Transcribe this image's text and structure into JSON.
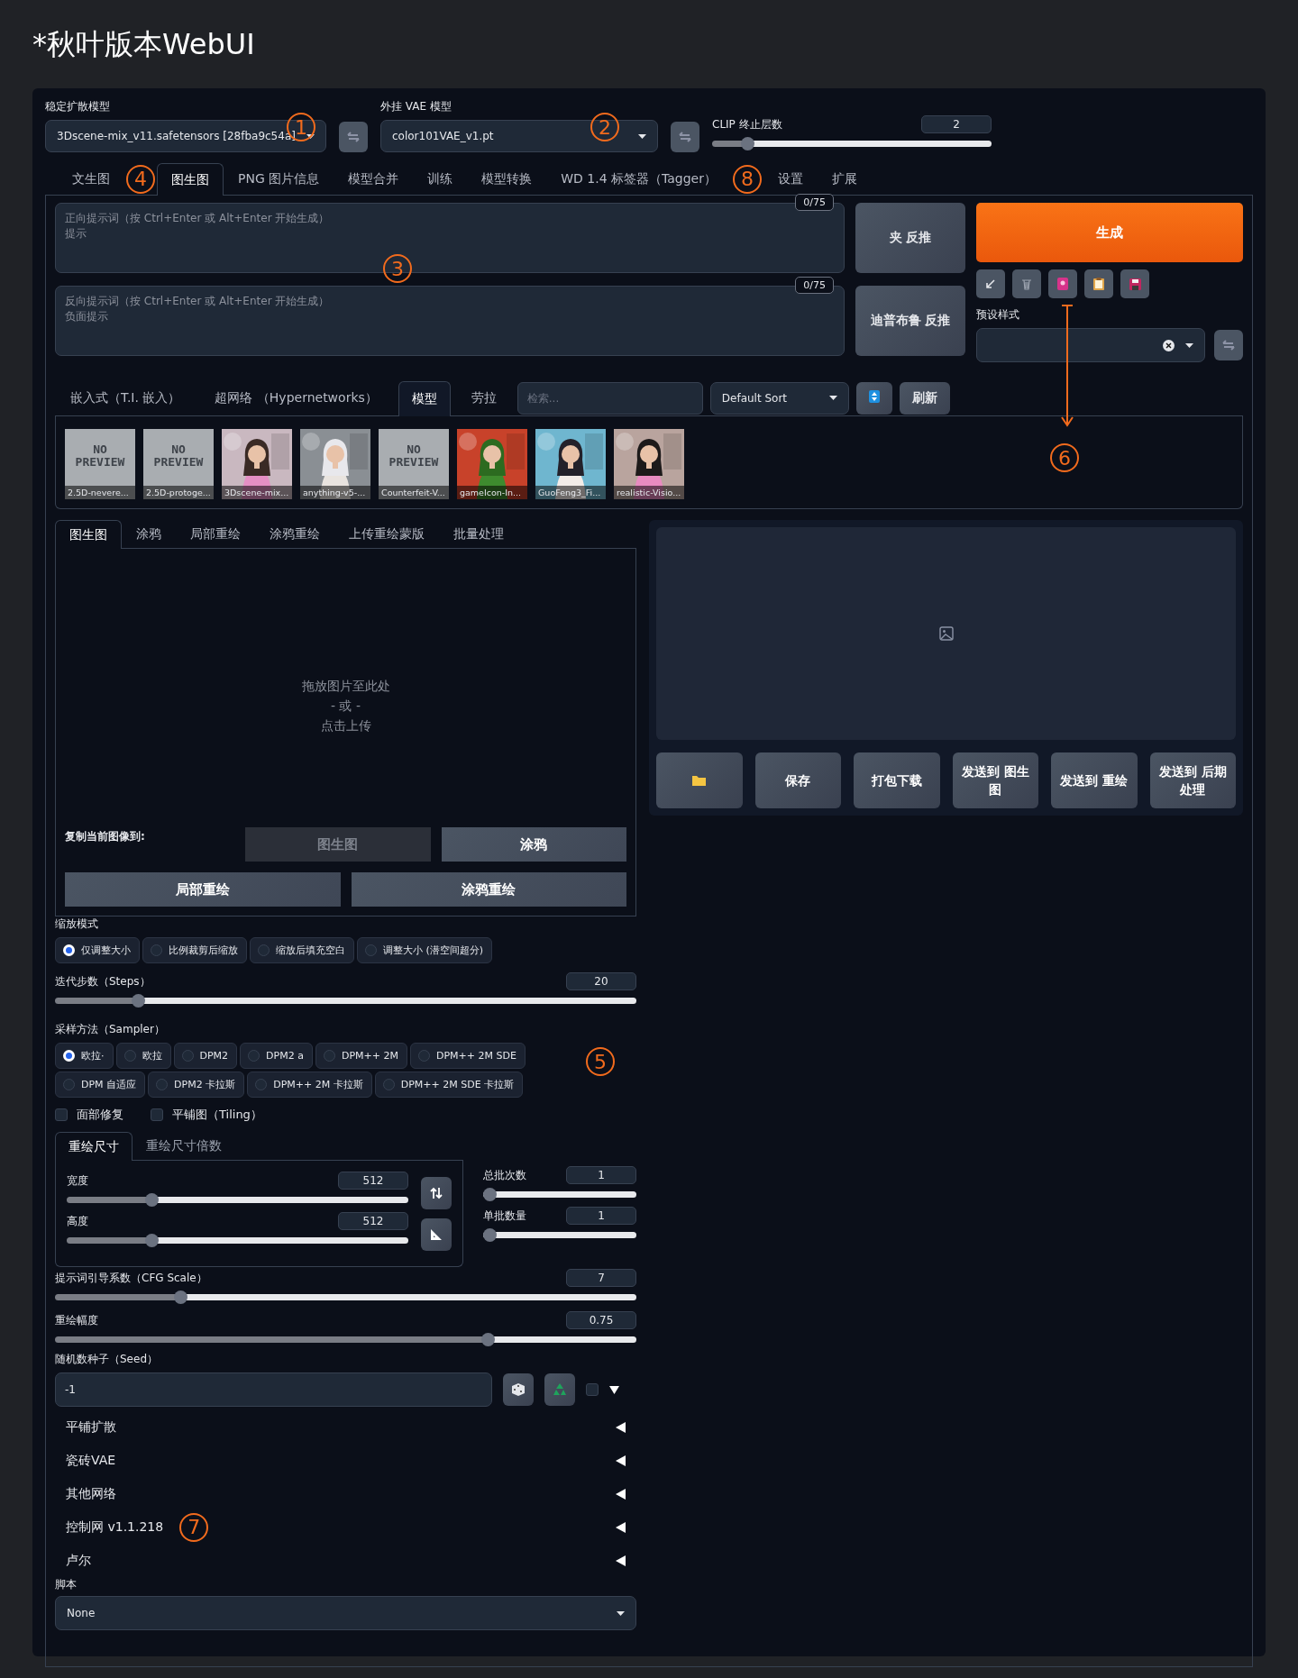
{
  "title": "*秋叶版本WebUI",
  "top": {
    "model": {
      "label": "稳定扩散模型",
      "value": "3Dscene-mix_v11.safetensors [28fba9c54a]"
    },
    "vae": {
      "label": "外挂 VAE 模型",
      "value": "color101VAE_v1.pt"
    },
    "clip": {
      "label": "CLIP 终止层数",
      "value": "2",
      "level": 0.11
    }
  },
  "tabs": [
    {
      "label": "文生图",
      "selected": false
    },
    {
      "label": "图生图",
      "selected": true
    },
    {
      "label": "PNG 图片信息",
      "selected": false
    },
    {
      "label": "模型合并",
      "selected": false
    },
    {
      "label": "训练",
      "selected": false
    },
    {
      "label": "模型转换",
      "selected": false
    },
    {
      "label": "WD 1.4 标签器（Tagger）",
      "selected": false
    },
    {
      "label": "设置",
      "selected": false
    },
    {
      "label": "扩展",
      "selected": false
    }
  ],
  "prompts": [
    {
      "placeholder": "正向提示词（按 Ctrl+Enter 或 Alt+Enter 开始生成）",
      "hint": "提示",
      "counter": "0/75"
    },
    {
      "placeholder": "反向提示词（按 Ctrl+Enter 或 Alt+Enter 开始生成）",
      "hint": "负面提示",
      "counter": "0/75"
    }
  ],
  "interrogate_buttons": [
    "夹 反推",
    "迪普布鲁 反推"
  ],
  "generate_button": "生成",
  "tool_icons": [
    {
      "kind": "arrow"
    },
    {
      "kind": "trash"
    },
    {
      "kind": "card"
    },
    {
      "kind": "clipboard"
    },
    {
      "kind": "save"
    }
  ],
  "styles": {
    "label": "预设样式"
  },
  "network_tabs": [
    {
      "label": "嵌入式（T.I. 嵌入）",
      "selected": false
    },
    {
      "label": "超网络 （Hypernetworks）",
      "selected": false
    },
    {
      "label": "模型",
      "selected": true
    },
    {
      "label": "劳拉",
      "selected": false
    }
  ],
  "network_search": {
    "placeholder": "检索..."
  },
  "sort": {
    "value": "Default Sort"
  },
  "refresh_button": "刷新",
  "cards": [
    {
      "kind": "no_preview",
      "preview_text": "NO PREVIEW",
      "label": "2.5D-nevere..."
    },
    {
      "kind": "no_preview",
      "preview_text": "NO PREVIEW",
      "label": "2.5D-protoge..."
    },
    {
      "kind": "picture",
      "label": "3Dscene-mix..."
    },
    {
      "kind": "picture",
      "label": "anything-v5-..."
    },
    {
      "kind": "no_preview",
      "preview_text": "NO PREVIEW",
      "label": "Counterfeit-V..."
    },
    {
      "kind": "picture",
      "label": "gameIcon-In..."
    },
    {
      "kind": "picture",
      "label": "GuoFeng3_Fi..."
    },
    {
      "kind": "picture",
      "label": "realistic-Visio..."
    }
  ],
  "img_tabs": [
    {
      "label": "图生图",
      "selected": true
    },
    {
      "label": "涂鸦",
      "selected": false
    },
    {
      "label": "局部重绘",
      "selected": false
    },
    {
      "label": "涂鸦重绘",
      "selected": false
    },
    {
      "label": "上传重绘蒙版",
      "selected": false
    },
    {
      "label": "批量处理",
      "selected": false
    }
  ],
  "drop_zone": [
    "拖放图片至此处",
    "- 或 -",
    "点击上传"
  ],
  "copy_to": {
    "label": "复制当前图像到:",
    "buttons": [
      {
        "label": "图生图",
        "disabled": true
      },
      {
        "label": "涂鸦",
        "disabled": false
      },
      {
        "label": "局部重绘",
        "disabled": false
      },
      {
        "label": "涂鸦重绘",
        "disabled": false
      }
    ]
  },
  "resize_mode": {
    "label": "缩放模式",
    "options": [
      {
        "label": "仅调整大小",
        "selected": true
      },
      {
        "label": "比例裁剪后缩放",
        "selected": false
      },
      {
        "label": "缩放后填充空白",
        "selected": false
      },
      {
        "label": "调整大小 (潜空间超分)",
        "selected": false
      }
    ]
  },
  "steps": {
    "label": "迭代步数（Steps）",
    "value": "20",
    "level": 0.135
  },
  "sampler": {
    "label": "采样方法（Sampler）",
    "options": [
      {
        "label": "欧拉·",
        "selected": true
      },
      {
        "label": "欧拉",
        "selected": false
      },
      {
        "label": "DPM2",
        "selected": false
      },
      {
        "label": "DPM2 a",
        "selected": false
      },
      {
        "label": "DPM++ 2M",
        "selected": false
      },
      {
        "label": "DPM++ 2M SDE",
        "selected": false
      },
      {
        "label": "DPM 自适应",
        "selected": false
      },
      {
        "label": "DPM2 卡拉斯",
        "selected": false
      },
      {
        "label": "DPM++ 2M 卡拉斯",
        "selected": false
      },
      {
        "label": "DPM++ 2M SDE 卡拉斯",
        "selected": false
      }
    ]
  },
  "checkboxes": [
    {
      "label": "面部修复",
      "checked": false
    },
    {
      "label": "平铺图（Tiling）",
      "checked": false
    }
  ],
  "size_tabs": [
    {
      "label": "重绘尺寸",
      "selected": true
    },
    {
      "label": "重绘尺寸倍数",
      "selected": false
    }
  ],
  "width": {
    "label": "宽度",
    "value": "512",
    "level": 0.24
  },
  "height": {
    "label": "高度",
    "value": "512",
    "level": 0.24
  },
  "batch_count": {
    "label": "总批次数",
    "value": "1",
    "level": 0
  },
  "batch_size": {
    "label": "单批数量",
    "value": "1",
    "level": 0
  },
  "cfg": {
    "label": "提示词引导系数（CFG Scale）",
    "value": "7",
    "level": 0.21
  },
  "denoise": {
    "label": "重绘幅度",
    "value": "0.75",
    "level": 0.75
  },
  "seed": {
    "label": "随机数种子（Seed）",
    "value": "-1",
    "extra_checked": false
  },
  "accordions": [
    {
      "label": "平铺扩散",
      "expanded": false
    },
    {
      "label": "瓷砖VAE",
      "expanded": false
    },
    {
      "label": "其他网络",
      "expanded": false
    },
    {
      "label": "控制网 v1.1.218",
      "expanded": false
    },
    {
      "label": "卢尔",
      "expanded": false
    }
  ],
  "script": {
    "label": "脚本",
    "value": "None"
  },
  "output_buttons": [
    {
      "kind": "folder"
    },
    {
      "kind": "text",
      "label": "保存"
    },
    {
      "kind": "text",
      "label": "打包下载"
    },
    {
      "kind": "text",
      "label": "发送到 图生图"
    },
    {
      "kind": "text",
      "label": "发送到 重绘"
    },
    {
      "kind": "text",
      "label": "发送到 后期处理"
    }
  ],
  "annotations": [
    {
      "label": "1"
    },
    {
      "label": "2"
    },
    {
      "label": "3"
    },
    {
      "label": "4"
    },
    {
      "label": "5"
    },
    {
      "label": "6"
    },
    {
      "label": "7"
    },
    {
      "label": "8"
    }
  ]
}
